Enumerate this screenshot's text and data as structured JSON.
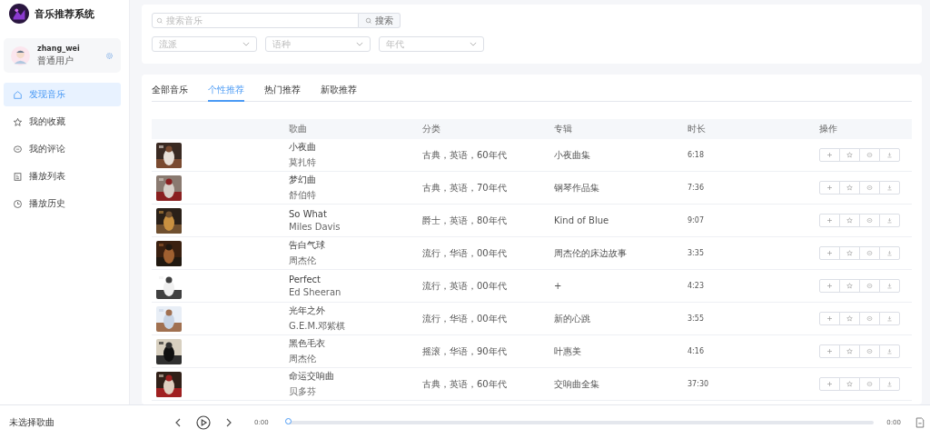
{
  "app": {
    "title": "音乐推荐系统"
  },
  "user": {
    "name": "zhang_wei",
    "role": "普通用户"
  },
  "nav": [
    {
      "label": "发现音乐",
      "selected": true
    },
    {
      "label": "我的收藏",
      "selected": false
    },
    {
      "label": "我的评论",
      "selected": false
    },
    {
      "label": "播放列表",
      "selected": false
    },
    {
      "label": "播放历史",
      "selected": false
    }
  ],
  "search": {
    "placeholder": "搜索音乐",
    "button": "搜索"
  },
  "filters": [
    {
      "placeholder": "流派"
    },
    {
      "placeholder": "语种"
    },
    {
      "placeholder": "年代"
    }
  ],
  "tabs": [
    {
      "label": "全部音乐",
      "selected": false
    },
    {
      "label": "个性推荐",
      "selected": true
    },
    {
      "label": "热门推荐",
      "selected": false
    },
    {
      "label": "新歌推荐",
      "selected": false
    }
  ],
  "table": {
    "columns": [
      "歌曲",
      "分类",
      "专辑",
      "时长",
      "操作"
    ],
    "rows": [
      {
        "title": "小夜曲",
        "artist": "莫扎特",
        "category": "古典，英语，60年代",
        "album": "小夜曲集",
        "duration": "6:18"
      },
      {
        "title": "梦幻曲",
        "artist": "舒伯特",
        "category": "古典，英语，70年代",
        "album": "钢琴作品集",
        "duration": "7:36"
      },
      {
        "title": "So What",
        "artist": "Miles Davis",
        "category": "爵士，英语，80年代",
        "album": "Kind of Blue",
        "duration": "9:07"
      },
      {
        "title": "告白气球",
        "artist": "周杰伦",
        "category": "流行，华语，00年代",
        "album": "周杰伦的床边故事",
        "duration": "3:35"
      },
      {
        "title": "Perfect",
        "artist": "Ed Sheeran",
        "category": "流行，英语，00年代",
        "album": "+",
        "duration": "4:23"
      },
      {
        "title": "光年之外",
        "artist": "G.E.M.邓紫棋",
        "category": "流行，华语，00年代",
        "album": "新的心跳",
        "duration": "3:55"
      },
      {
        "title": "黑色毛衣",
        "artist": "周杰伦",
        "category": "摇滚，华语，90年代",
        "album": "叶惠美",
        "duration": "4:16"
      },
      {
        "title": "命运交响曲",
        "artist": "贝多芬",
        "category": "古典，英语，60年代",
        "album": "交响曲全集",
        "duration": "37:30"
      }
    ]
  },
  "player": {
    "now_playing": "未选择歌曲",
    "current_time": "0:00",
    "total_time": "0:00",
    "level": 0
  }
}
